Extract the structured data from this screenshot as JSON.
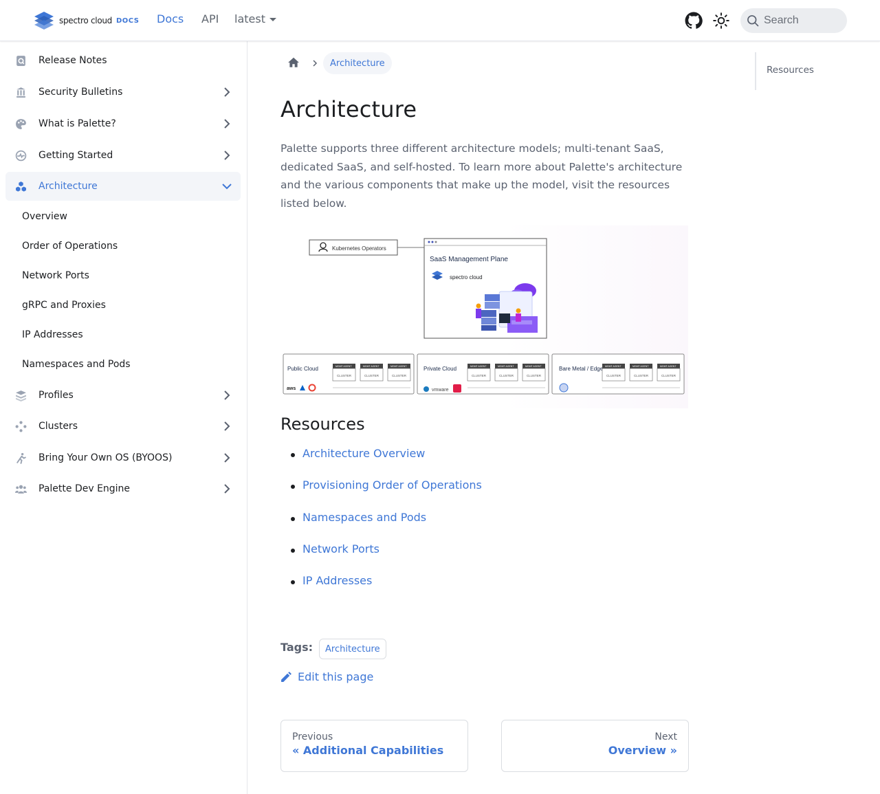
{
  "navbar": {
    "logo_text": "spectro cloud",
    "logo_docs": "DOCS",
    "links": [
      "Docs",
      "API"
    ],
    "version": "latest",
    "search_placeholder": "Search"
  },
  "sidebar": {
    "items": [
      {
        "label": "Release Notes",
        "icon": "search-doc-icon"
      },
      {
        "label": "Security Bulletins",
        "icon": "bank-icon"
      },
      {
        "label": "What is Palette?",
        "icon": "palette-icon"
      },
      {
        "label": "Getting Started",
        "icon": "pulse-icon"
      },
      {
        "label": "Architecture",
        "icon": "cubes-icon"
      },
      {
        "label": "Profiles",
        "icon": "layers-icon"
      },
      {
        "label": "Clusters",
        "icon": "nodes-icon"
      },
      {
        "label": "Bring Your Own OS (BYOOS)",
        "icon": "person-running-icon"
      },
      {
        "label": "Palette Dev Engine",
        "icon": "users-icon"
      }
    ],
    "subitems": [
      "Overview",
      "Order of Operations",
      "Network Ports",
      "gRPC and Proxies",
      "IP Addresses",
      "Namespaces and Pods"
    ]
  },
  "breadcrumb": {
    "current": "Architecture"
  },
  "main": {
    "title": "Architecture",
    "intro": "Palette supports three different architecture models; multi-tenant SaaS, dedicated SaaS, and self-hosted. To learn more about Palette's architecture and the various components that make up the model, visit the resources listed below.",
    "diagram": {
      "k8s_ops": "Kubernetes Operators",
      "mgmt_plane": "SaaS Management Plane",
      "mgmt_logo": "spectro cloud",
      "envs": [
        "Public Cloud",
        "Private Cloud",
        "Bare Metal / Edge"
      ],
      "agent": "MGMT AGENT",
      "cluster": "CLUSTER",
      "public_logos": "aws",
      "private_logos": "vmware"
    },
    "resources_heading": "Resources",
    "resources": [
      "Architecture Overview",
      "Provisioning Order of Operations",
      "Namespaces and Pods",
      "Network Ports",
      "IP Addresses"
    ],
    "tags_label": "Tags:",
    "tag": "Architecture",
    "edit_label": "Edit this page",
    "prev": {
      "sub": "Previous",
      "label": "« Additional Capabilities"
    },
    "next": {
      "sub": "Next",
      "label": "Overview »"
    }
  },
  "toc": {
    "items": [
      "Resources"
    ]
  },
  "colors": {
    "accent": "#3f77d6",
    "text": "#1c1e21",
    "muted": "#5b6270"
  }
}
